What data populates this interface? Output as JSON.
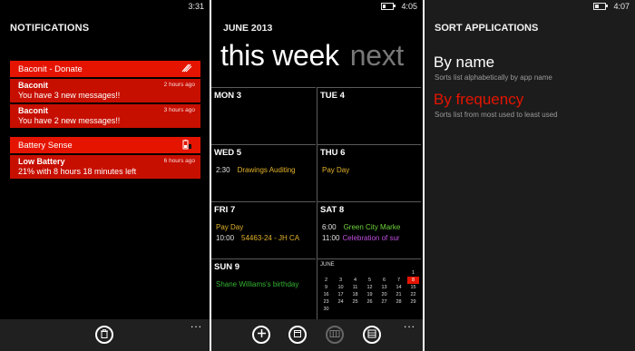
{
  "accent_color": "#e51400",
  "notifications": {
    "status_time": "3:31",
    "title": "NOTIFICATIONS",
    "groups": [
      {
        "app": "Baconit - Donate",
        "icon": "bacon-icon",
        "items": [
          {
            "title": "Baconit",
            "message": "You have 3 new messages!!",
            "time": "2 hours ago"
          },
          {
            "title": "Baconit",
            "message": "You have 2 new messages!!",
            "time": "3 hours ago"
          }
        ]
      },
      {
        "app": "Battery Sense",
        "icon": "battery-icon",
        "items": [
          {
            "title": "Low Battery",
            "message": "21% with 8 hours 18 minutes left",
            "time": "6 hours ago"
          }
        ]
      }
    ],
    "appbar": {
      "buttons": [
        "delete-icon"
      ],
      "more": "..."
    }
  },
  "calendar": {
    "status_time": "4:05",
    "month": "JUNE 2013",
    "week_current": "this week",
    "week_next": "next",
    "days": [
      {
        "name": "MON 3",
        "events": []
      },
      {
        "name": "TUE 4",
        "events": []
      },
      {
        "name": "WED 5",
        "events": [
          {
            "time": "2:30",
            "title": "Drawings Auditing",
            "color": "#e3b22a"
          }
        ]
      },
      {
        "name": "THU 6",
        "events": [
          {
            "time": "",
            "title": "Pay Day",
            "color": "#e3b22a"
          }
        ]
      },
      {
        "name": "FRI 7",
        "events": [
          {
            "time": "",
            "title": "Pay Day",
            "color": "#e3b22a"
          },
          {
            "time": "10:00",
            "title": "54463-24 - JH CA",
            "color": "#e3b22a"
          }
        ]
      },
      {
        "name": "SAT 8",
        "events": [
          {
            "time": "6:00",
            "title": "Green City Marke",
            "color": "#6ed23a"
          },
          {
            "time": "11:00",
            "title": "Celebration of sur",
            "color": "#c04fe0"
          }
        ]
      },
      {
        "name": "SUN 9",
        "events": [
          {
            "time": "",
            "title": "Shane Williams's birthday",
            "color": "#33b533"
          }
        ]
      }
    ],
    "mini_month": {
      "label": "JUNE",
      "weeks": [
        [
          "",
          "",
          "",
          "",
          "",
          "",
          "1"
        ],
        [
          "2",
          "3",
          "4",
          "5",
          "6",
          "7",
          "8"
        ],
        [
          "9",
          "10",
          "11",
          "12",
          "13",
          "14",
          "15"
        ],
        [
          "16",
          "17",
          "18",
          "19",
          "20",
          "21",
          "22"
        ],
        [
          "23",
          "24",
          "25",
          "26",
          "27",
          "28",
          "29"
        ],
        [
          "30",
          "",
          "",
          "",
          "",
          "",
          ""
        ]
      ],
      "today": "8"
    },
    "appbar": {
      "buttons": [
        "add-icon",
        "day-view-icon",
        "week-view-icon",
        "month-view-icon"
      ],
      "more": "..."
    }
  },
  "sort": {
    "status_time": "4:07",
    "title": "SORT APPLICATIONS",
    "options": [
      {
        "label": "By name",
        "desc": "Sorts list alphabetically by app name",
        "selected": false
      },
      {
        "label": "By frequency",
        "desc": "Sorts list from most used to least used",
        "selected": true
      }
    ]
  }
}
